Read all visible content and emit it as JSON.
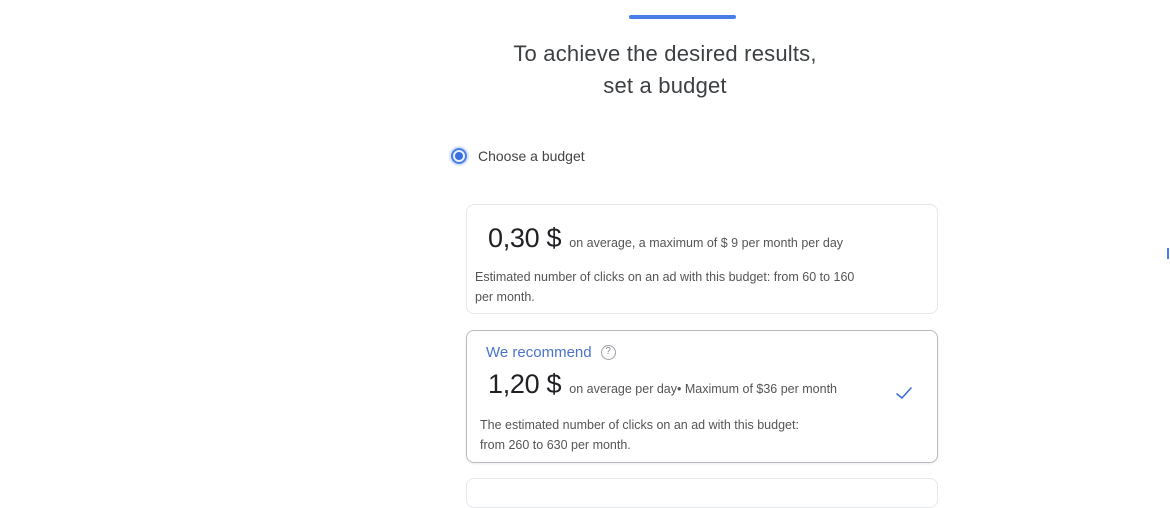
{
  "progress": {
    "color": "#4a7de8"
  },
  "heading": {
    "line1": "To achieve the desired results,",
    "line2": "set a budget"
  },
  "budget_option": {
    "label": "Choose a budget",
    "selected": true
  },
  "cards": [
    {
      "price": "0,30 $",
      "description": "on average, a maximum of $ 9 per month per day",
      "estimate": "Estimated number of clicks on an ad with this budget: from 60 to 160 per month."
    },
    {
      "recommend_label": "We recommend",
      "help_icon": "question-circle-icon",
      "price": "1,20 $",
      "description": "on average per day• Maximum of $36 per month",
      "estimate": "The estimated number of clicks on an ad with this budget: from 260 to 630 per month.",
      "selected": true,
      "check_icon": "check-icon"
    }
  ],
  "colors": {
    "accent": "#4a7de8",
    "recommend_text": "#4a73c9"
  }
}
